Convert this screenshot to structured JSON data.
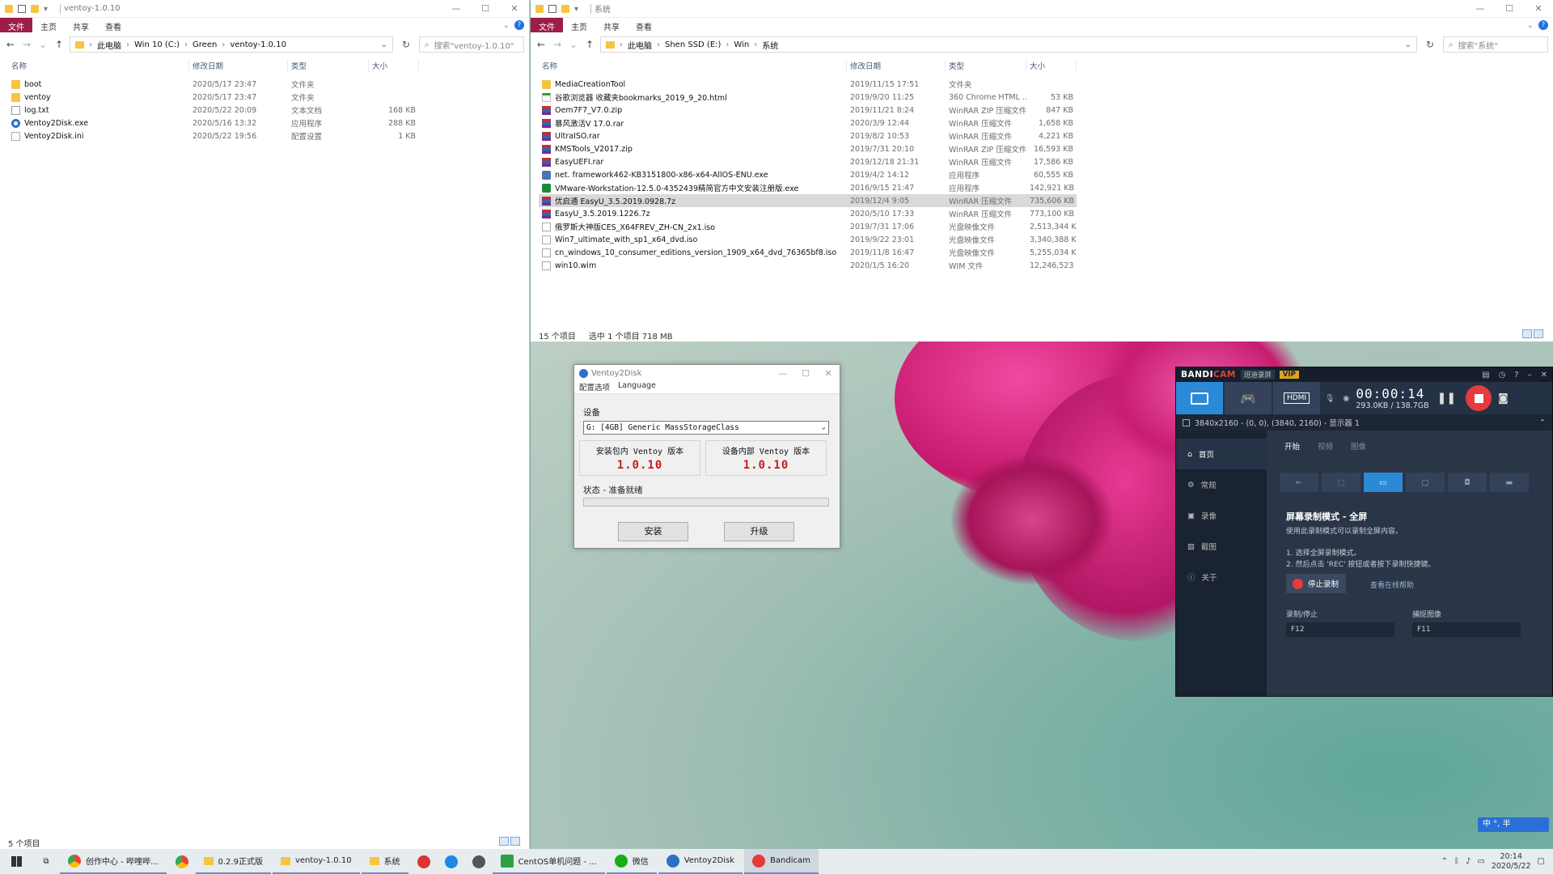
{
  "left_explorer": {
    "title": "ventoy-1.0.10",
    "ribbon": [
      "文件",
      "主页",
      "共享",
      "查看"
    ],
    "breadcrumb": [
      "此电脑",
      "Win 10 (C:)",
      "Green",
      "ventoy-1.0.10"
    ],
    "search_placeholder": "搜索\"ventoy-1.0.10\"",
    "columns": [
      "名称",
      "修改日期",
      "类型",
      "大小"
    ],
    "files": [
      {
        "name": "boot",
        "date": "2020/5/17 23:47",
        "type": "文件夹",
        "size": "",
        "icon": "folder"
      },
      {
        "name": "ventoy",
        "date": "2020/5/17 23:47",
        "type": "文件夹",
        "size": "",
        "icon": "folder"
      },
      {
        "name": "log.txt",
        "date": "2020/5/22 20:09",
        "type": "文本文档",
        "size": "168 KB",
        "icon": "txt"
      },
      {
        "name": "Ventoy2Disk.exe",
        "date": "2020/5/16 13:32",
        "type": "应用程序",
        "size": "288 KB",
        "icon": "exe"
      },
      {
        "name": "Ventoy2Disk.ini",
        "date": "2020/5/22 19:56",
        "type": "配置设置",
        "size": "1 KB",
        "icon": "ini"
      }
    ],
    "status": "5 个项目"
  },
  "right_explorer": {
    "title": "系统",
    "ribbon": [
      "文件",
      "主页",
      "共享",
      "查看"
    ],
    "breadcrumb": [
      "此电脑",
      "Shen SSD (E:)",
      "Win",
      "系统"
    ],
    "search_placeholder": "搜索\"系统\"",
    "columns": [
      "名称",
      "修改日期",
      "类型",
      "大小"
    ],
    "files": [
      {
        "name": "MediaCreationTool",
        "date": "2019/11/15 17:51",
        "type": "文件夹",
        "size": "",
        "icon": "folder"
      },
      {
        "name": "谷歌浏览器 收藏夹bookmarks_2019_9_20.html",
        "date": "2019/9/20 11:25",
        "type": "360 Chrome HTML ...",
        "size": "53 KB",
        "icon": "html"
      },
      {
        "name": "Oem7F7_V7.0.zip",
        "date": "2019/11/21 8:24",
        "type": "WinRAR ZIP 压缩文件",
        "size": "847 KB",
        "icon": "rar"
      },
      {
        "name": "暴风激活V 17.0.rar",
        "date": "2020/3/9 12:44",
        "type": "WinRAR 压缩文件",
        "size": "1,658 KB",
        "icon": "rar"
      },
      {
        "name": "UltraISO.rar",
        "date": "2019/8/2 10:53",
        "type": "WinRAR 压缩文件",
        "size": "4,221 KB",
        "icon": "rar"
      },
      {
        "name": "KMSTools_V2017.zip",
        "date": "2019/7/31 20:10",
        "type": "WinRAR ZIP 压缩文件",
        "size": "16,593 KB",
        "icon": "rar"
      },
      {
        "name": "EasyUEFI.rar",
        "date": "2019/12/18 21:31",
        "type": "WinRAR 压缩文件",
        "size": "17,586 KB",
        "icon": "rar"
      },
      {
        "name": "net. framework462-KB3151800-x86-x64-AllOS-ENU.exe",
        "date": "2019/4/2 14:12",
        "type": "应用程序",
        "size": "60,555 KB",
        "icon": "exe2"
      },
      {
        "name": "VMware-Workstation-12.5.0-4352439精简官方中文安装注册版.exe",
        "date": "2016/9/15 21:47",
        "type": "应用程序",
        "size": "142,921 KB",
        "icon": "vm"
      },
      {
        "name": "优启通 EasyU_3.5.2019.0928.7z",
        "date": "2019/12/4 9:05",
        "type": "WinRAR 压缩文件",
        "size": "735,606 KB",
        "icon": "rar",
        "selected": true
      },
      {
        "name": "EasyU_3.5.2019.1226.7z",
        "date": "2020/5/10 17:33",
        "type": "WinRAR 压缩文件",
        "size": "773,100 KB",
        "icon": "rar"
      },
      {
        "name": "俄罗斯大神版CES_X64FREV_ZH-CN_2x1.iso",
        "date": "2019/7/31 17:06",
        "type": "光盘映像文件",
        "size": "2,513,344 KB",
        "icon": "iso"
      },
      {
        "name": "Win7_ultimate_with_sp1_x64_dvd.iso",
        "date": "2019/9/22 23:01",
        "type": "光盘映像文件",
        "size": "3,340,388 KB",
        "icon": "iso"
      },
      {
        "name": "cn_windows_10_consumer_editions_version_1909_x64_dvd_76365bf8.iso",
        "date": "2019/11/8 16:47",
        "type": "光盘映像文件",
        "size": "5,255,034 KB",
        "icon": "iso"
      },
      {
        "name": "win10.wim",
        "date": "2020/1/5 16:20",
        "type": "WIM 文件",
        "size": "12,246,523 ...",
        "icon": "iso"
      }
    ],
    "status_count": "15 个项目",
    "status_selected": "选中 1 个项目  718 MB"
  },
  "ventoy": {
    "title": "Ventoy2Disk",
    "menu": [
      "配置选项",
      "Language"
    ],
    "device_label": "设备",
    "device_value": "G: [4GB] Generic MassStorageClass",
    "pkg_version_label": "安装包内 Ventoy 版本",
    "pkg_version": "1.0.10",
    "dev_version_label": "设备内部 Ventoy 版本",
    "dev_version": "1.0.10",
    "status": "状态 - 准备就绪",
    "install_label": "安装",
    "upgrade_label": "升级"
  },
  "bandicam": {
    "logo_a": "BANDI",
    "logo_b": "CAM",
    "tag": "班迪录屏",
    "vip": "VIP",
    "timer": "00:00:14",
    "size": "293.0KB / 138.7GB",
    "resolution": "3840x2160 - (0, 0), (3840, 2160) - 显示器 1",
    "sidebar": [
      "首页",
      "常规",
      "录像",
      "截图",
      "关于"
    ],
    "tabs": [
      "开始",
      "视频",
      "图像"
    ],
    "heading": "屏幕录制模式 - 全屏",
    "desc": "使用此录制模式可以录制全屏内容。",
    "step1": "1. 选择全屏录制模式。",
    "step2": "2. 然后点击 'REC' 按钮或者按下录制快捷键。",
    "stop_label": "停止录制",
    "help_link": "查看在线帮助",
    "hotkey_rec_label": "录制/停止",
    "hotkey_rec": "F12",
    "hotkey_cap_label": "捕捉图像",
    "hotkey_cap": "F11"
  },
  "taskbar": {
    "buttons": [
      "创作中心 - 哔哩哔...",
      "0.2.9正式版",
      "ventoy-1.0.10",
      "系统",
      "CentOS单机问题 - ...",
      "微信",
      "Ventoy2Disk",
      "Bandicam"
    ],
    "time": "20:14",
    "date": "2020/5/22",
    "ime": "中 °, 半"
  }
}
